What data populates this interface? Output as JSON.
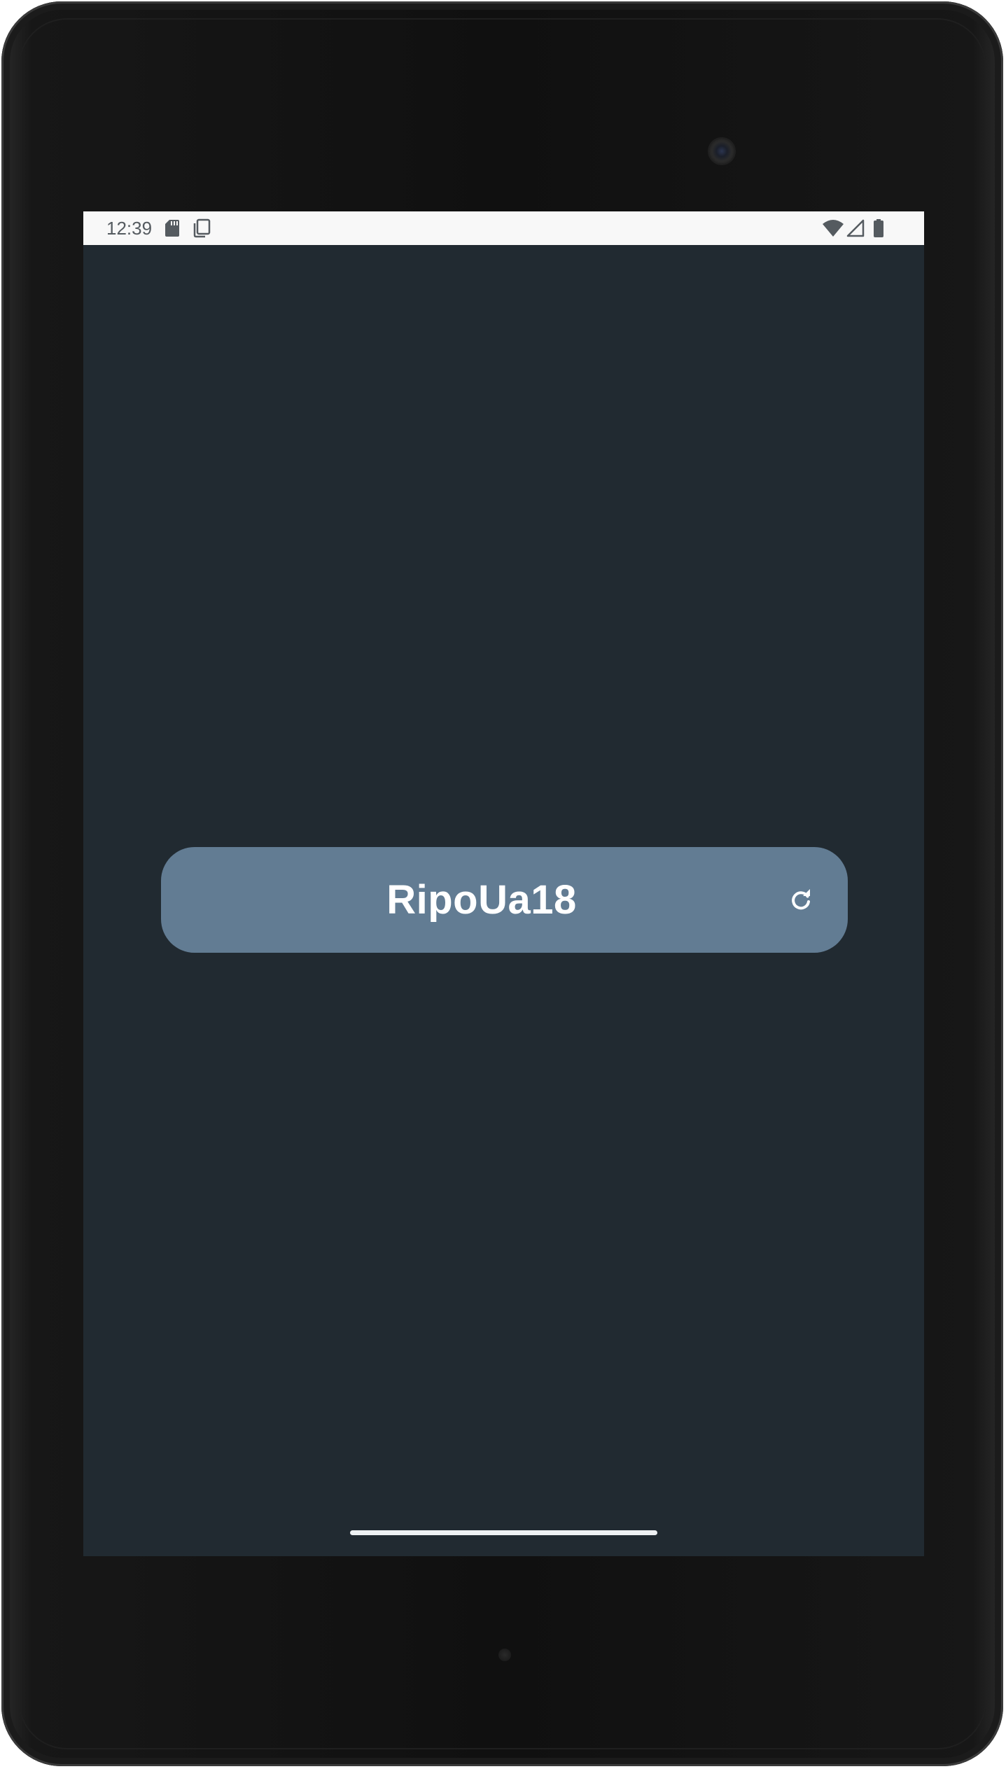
{
  "status_bar": {
    "time": "12:39",
    "left_icons": [
      "sd-card-icon",
      "copy-icon"
    ],
    "right_icons": [
      "wifi-icon",
      "cell-signal-icon",
      "battery-icon"
    ]
  },
  "main": {
    "code_button": {
      "label": "RipoUa18",
      "icon": "refresh-icon"
    }
  },
  "colors": {
    "screen_background": "#212a31",
    "button_background": "#627c93",
    "status_bar_background": "#f8f8f8",
    "status_icons": "#555b60"
  }
}
